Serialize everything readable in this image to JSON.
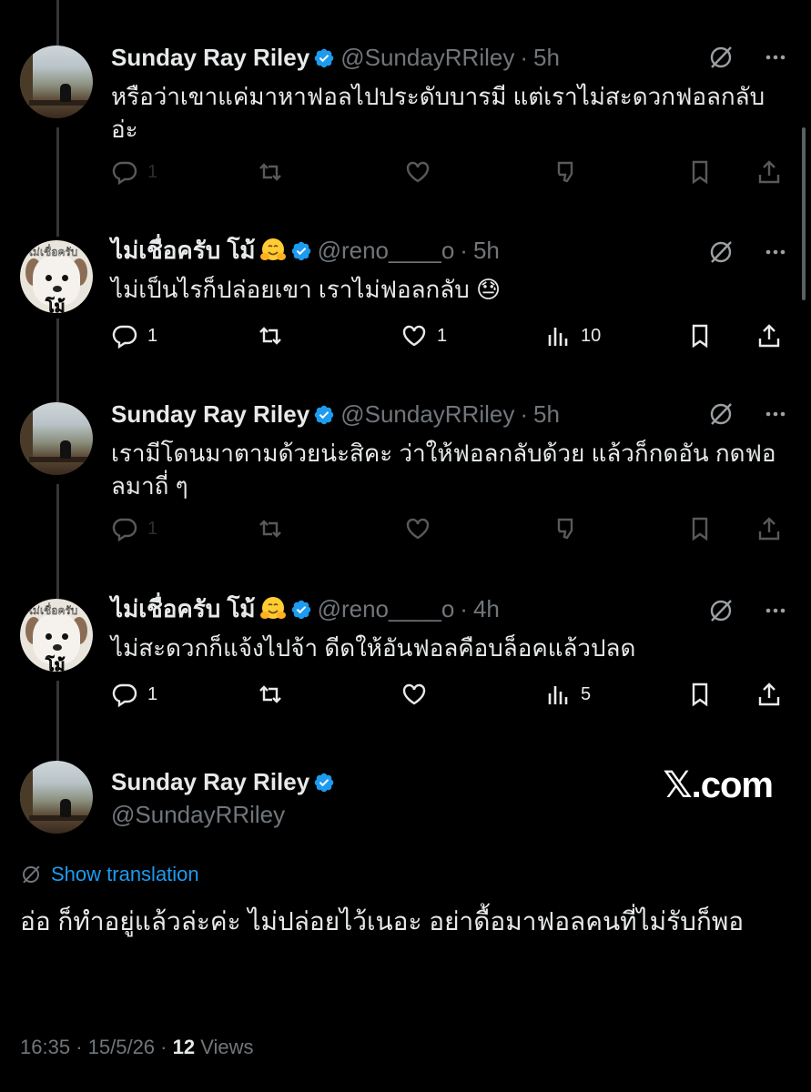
{
  "replies": [
    {
      "name": "Sunday Ray Riley",
      "handle": "@SundayRRiley",
      "time": "5h",
      "text": "หรือว่าเขาแค่มาหาฟอลไปประดับบารมี แต่เราไม่สะดวกฟอลกลับอ่ะ",
      "reply_count": "1",
      "retweet_count": "",
      "like_count": "",
      "views": ""
    },
    {
      "name": "ไม่เชื่อครับ โม้",
      "handle": "@reno____o",
      "time": "5h",
      "text": "ไม่เป็นไรก็ปล่อยเขา เราไม่ฟอลกลับ 😓",
      "reply_count": "1",
      "retweet_count": "",
      "like_count": "1",
      "views": "10",
      "avatar_caption_top": "ไม่เชื่อครับ",
      "avatar_caption_bottom": "โม้"
    },
    {
      "name": "Sunday Ray Riley",
      "handle": "@SundayRRiley",
      "time": "5h",
      "text": "เรามีโดนมาตามด้วยน่ะสิคะ ว่าให้ฟอลกลับด้วย แล้วก็กดอัน กดฟอลมาถี่ ๆ",
      "reply_count": "1",
      "retweet_count": "",
      "like_count": "",
      "views": ""
    },
    {
      "name": "ไม่เชื่อครับ โม้",
      "handle": "@reno____o",
      "time": "4h",
      "text": "ไม่สะดวกก็แจ้งไปจ้า ดีดให้อันฟอลคือบล็อคแล้วปลด",
      "reply_count": "1",
      "retweet_count": "",
      "like_count": "",
      "views": "5",
      "avatar_caption_top": "ไม่เชื่อครับ",
      "avatar_caption_bottom": "โม้"
    }
  ],
  "dot": "·",
  "main": {
    "name": "Sunday Ray Riley",
    "handle": "@SundayRRiley",
    "watermark": "𝕏.com",
    "show_translation": "Show translation",
    "text": "อ่อ ก็ทำอยู่แล้วล่ะค่ะ ไม่ปล่อยไว้เนอะ อย่าดื้อมาฟอลคนที่ไม่รับก็พอ",
    "time": "16:35",
    "date": "15/5/26",
    "views": "12",
    "views_label": "Views"
  },
  "colors": {
    "background": "#000000",
    "text": "#e7e9ea",
    "muted": "#71767b",
    "accent": "#1d9bf0",
    "verified": "#1d9bf0"
  },
  "icons": [
    "verified-badge-icon",
    "grok-icon",
    "more-icon",
    "reply-icon",
    "retweet-icon",
    "like-icon",
    "downvote-icon",
    "views-icon",
    "bookmark-icon",
    "share-icon",
    "translate-icon",
    "hugging-face-emoji"
  ]
}
